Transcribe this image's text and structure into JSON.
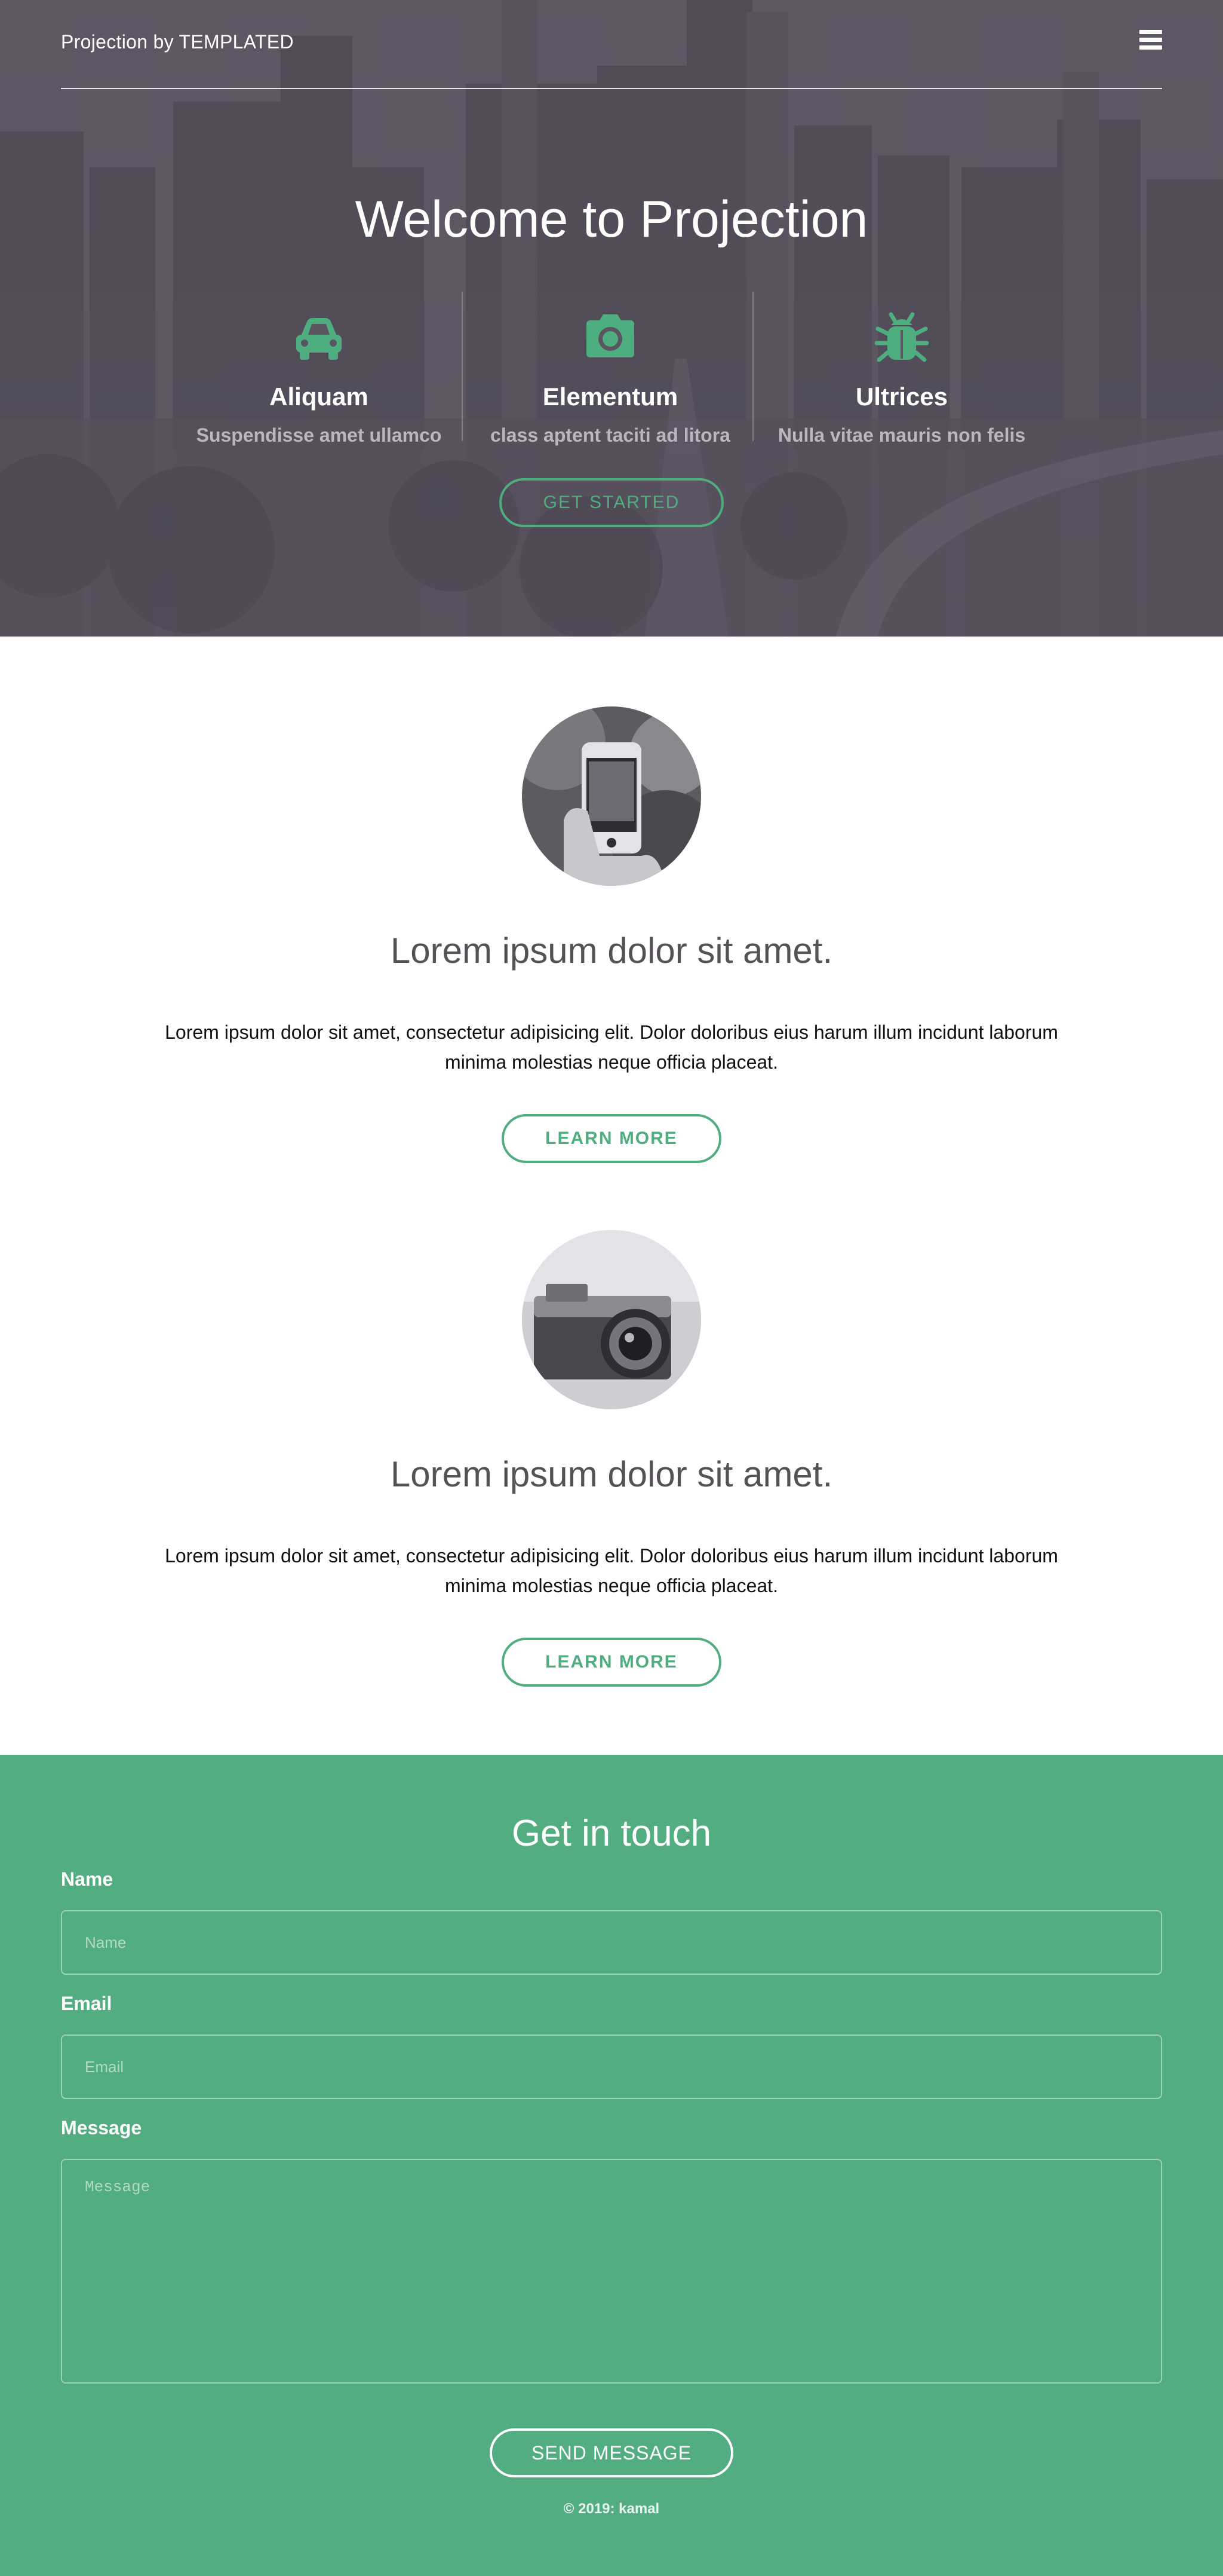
{
  "header": {
    "brand": "Projection by TEMPLATED",
    "menu_icon": "hamburger-menu-icon"
  },
  "hero": {
    "title": "Welcome to Projection",
    "features": [
      {
        "icon": "car-icon",
        "title": "Aliquam",
        "subtitle": "Suspendisse amet ullamco"
      },
      {
        "icon": "camera-icon",
        "title": "Elementum",
        "subtitle": "class aptent taciti ad litora"
      },
      {
        "icon": "bug-icon",
        "title": "Ultrices",
        "subtitle": "Nulla vitae mauris non felis"
      }
    ],
    "cta_label": "GET STARTED"
  },
  "spotlights": [
    {
      "image": "phone-photo",
      "title": "Lorem ipsum dolor sit amet.",
      "text": "Lorem ipsum dolor sit amet, consectetur adipisicing elit. Dolor doloribus eius harum illum incidunt laborum minima molestias neque officia placeat.",
      "button_label": "LEARN MORE"
    },
    {
      "image": "camera-photo",
      "title": "Lorem ipsum dolor sit amet.",
      "text": "Lorem ipsum dolor sit amet, consectetur adipisicing elit. Dolor doloribus eius harum illum incidunt laborum minima molestias neque officia placeat.",
      "button_label": "LEARN MORE"
    }
  ],
  "contact": {
    "title": "Get in touch",
    "name_label": "Name",
    "name_placeholder": "Name",
    "email_label": "Email",
    "email_placeholder": "Email",
    "message_label": "Message",
    "message_placeholder": "Message",
    "send_label": "SEND MESSAGE"
  },
  "footer": {
    "copyright": "© 2019: kamal"
  },
  "colors": {
    "accent": "#52ad80",
    "hero_overlay": "#5c5664",
    "text_dark": "#555157"
  }
}
